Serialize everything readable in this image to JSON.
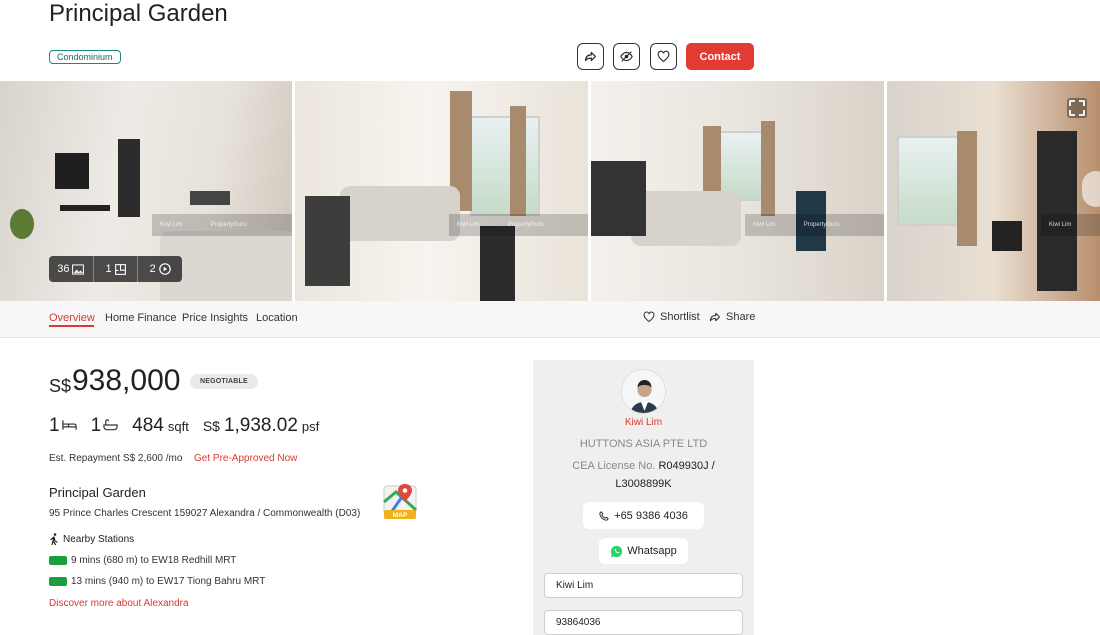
{
  "listing": {
    "title": "Principal Garden",
    "property_type": "Condominium",
    "contact_label": "Contact"
  },
  "gallery": {
    "photo_count": "36",
    "floorplan_count": "1",
    "video_count": "2",
    "watermark_agent": "Kiwi Lim",
    "watermark_brand": "PropertyGuru"
  },
  "tabs": {
    "items": [
      "Overview",
      "Home Finance",
      "Price Insights",
      "Location"
    ],
    "shortlist_label": "Shortlist",
    "share_label": "Share"
  },
  "price": {
    "currency": "S$",
    "amount": "938,000",
    "negotiable": "NEGOTIABLE"
  },
  "specs": {
    "bedrooms": "1",
    "bathrooms": "1",
    "area": "484",
    "area_unit": "sqft",
    "psf_currency": "S$",
    "psf_value": "1,938.02",
    "psf_unit": "psf"
  },
  "finance": {
    "repayment": "Est. Repayment S$ 2,600 /mo",
    "preapproved_link": "Get Pre-Approved Now"
  },
  "address": {
    "name": "Principal Garden",
    "line": "95 Prince Charles Crescent 159027 Alexandra / Commonwealth (D03)",
    "map_label": "MAP"
  },
  "nearby": {
    "title": "Nearby Stations",
    "stations": [
      {
        "text": "9 mins (680 m) to EW18 Redhill MRT",
        "color": "#1b9e3e"
      },
      {
        "text": "13 mins (940 m) to EW17 Tiong Bahru MRT",
        "color": "#1b9e3e"
      }
    ],
    "discover_link": "Discover more about Alexandra"
  },
  "agent": {
    "name": "Kiwi Lim",
    "company": "HUTTONS ASIA PTE LTD",
    "license_label": "CEA License No.",
    "license_number": "R049930J /",
    "license_number_2": "L3008899K",
    "phone": "+65 9386 4036",
    "whatsapp_label": "Whatsapp",
    "form_name_value": "Kiwi Lim",
    "form_phone_value": "93864036"
  },
  "colors": {
    "accent": "#e33b34",
    "mrt_green": "#1b9e3e",
    "tag_teal": "#1a8a7a"
  }
}
